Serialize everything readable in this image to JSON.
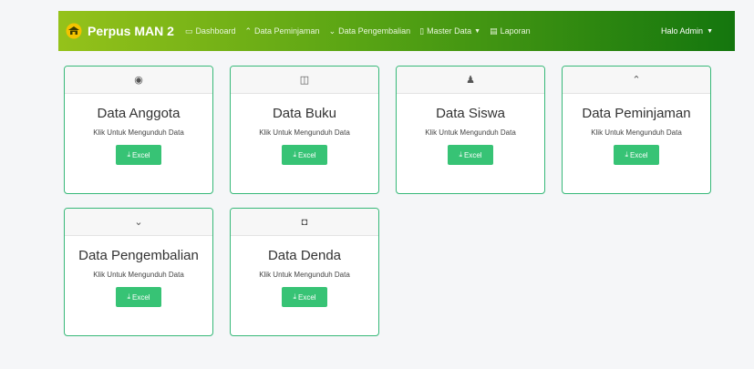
{
  "navbar": {
    "brand": "Perpus MAN 2",
    "items": [
      {
        "icon": "monitor-icon",
        "glyph": "▭",
        "label": "Dashboard"
      },
      {
        "icon": "chevrons-up-icon",
        "glyph": "⌃",
        "label": "Data Peminjaman"
      },
      {
        "icon": "chevrons-down-icon",
        "glyph": "⌄",
        "label": "Data Pengembalian"
      },
      {
        "icon": "file-icon",
        "glyph": "▯",
        "label": "Master Data"
      },
      {
        "icon": "document-icon",
        "glyph": "▤",
        "label": "Laporan"
      }
    ],
    "user": "Halo Admin"
  },
  "cards": [
    {
      "icon": "user-circle-icon",
      "glyph": "◉",
      "title": "Data Anggota",
      "subtitle": "Klik Untuk Mengunduh Data",
      "button": "Excel"
    },
    {
      "icon": "book-icon",
      "glyph": "◫",
      "title": "Data Buku",
      "subtitle": "Klik Untuk Mengunduh Data",
      "button": "Excel"
    },
    {
      "icon": "users-icon",
      "glyph": "♟",
      "title": "Data Siswa",
      "subtitle": "Klik Untuk Mengunduh Data",
      "button": "Excel"
    },
    {
      "icon": "chevrons-up-icon",
      "glyph": "⌃",
      "title": "Data Peminjaman",
      "subtitle": "Klik Untuk Mengunduh Data",
      "button": "Excel"
    },
    {
      "icon": "chevrons-down-icon",
      "glyph": "⌄",
      "title": "Data Pengembalian",
      "subtitle": "Klik Untuk Mengunduh Data",
      "button": "Excel"
    },
    {
      "icon": "money-icon",
      "glyph": "◘",
      "title": "Data Denda",
      "subtitle": "Klik Untuk Mengunduh Data",
      "button": "Excel"
    }
  ],
  "colors": {
    "accent": "#37c375",
    "nav_start": "#95c21a",
    "nav_end": "#14760e",
    "card_border": "#36b878"
  }
}
